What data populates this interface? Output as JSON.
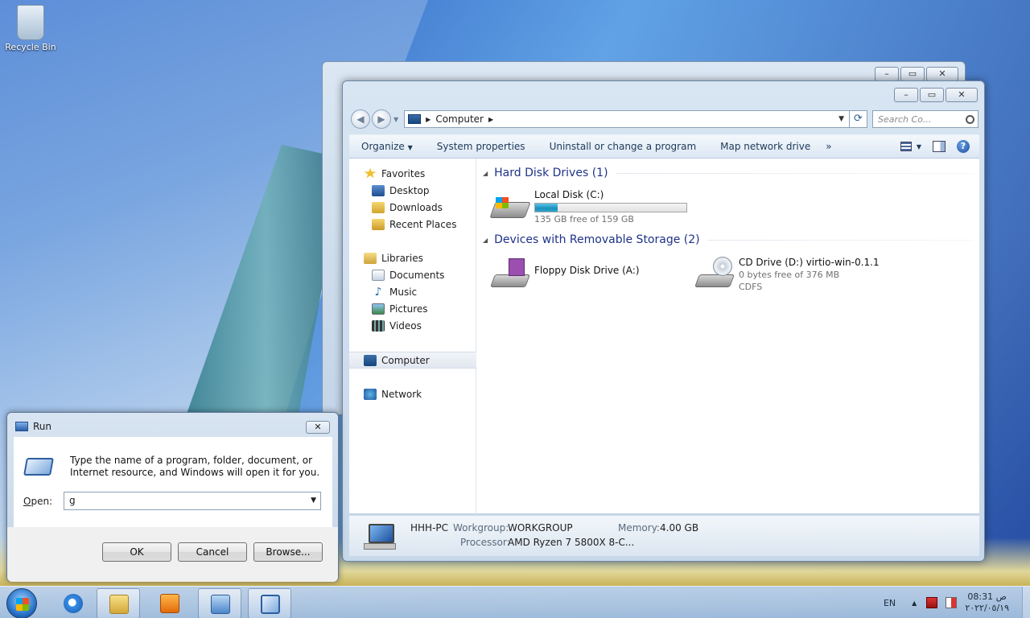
{
  "desktop": {
    "icons": [
      {
        "label": "Recycle Bin",
        "icon": "recycle-bin-icon"
      }
    ]
  },
  "explorer": {
    "address": {
      "crumb": "Computer"
    },
    "search_placeholder": "Search Co...",
    "toolbar": {
      "organize": "Organize",
      "system_properties": "System properties",
      "uninstall": "Uninstall or change a program",
      "map_drive": "Map network drive",
      "more": "»"
    },
    "nav": {
      "favorites": "Favorites",
      "desktop": "Desktop",
      "downloads": "Downloads",
      "recent_places": "Recent Places",
      "libraries": "Libraries",
      "documents": "Documents",
      "music": "Music",
      "pictures": "Pictures",
      "videos": "Videos",
      "computer": "Computer",
      "network": "Network"
    },
    "groups": {
      "hdd": "Hard Disk Drives (1)",
      "removable": "Devices with Removable Storage (2)"
    },
    "drives": {
      "local": {
        "name": "Local Disk (C:)",
        "free": "135 GB free of 159 GB",
        "used_fraction": 0.15
      },
      "floppy": {
        "name": "Floppy Disk Drive (A:)"
      },
      "cd": {
        "name": "CD Drive (D:) virtio-win-0.1.1",
        "free": "0 bytes free of 376 MB",
        "fs": "CDFS"
      }
    },
    "details": {
      "pc_name": "HHH-PC",
      "workgroup_label": "Workgroup:",
      "workgroup": "WORKGROUP",
      "memory_label": "Memory:",
      "memory": "4.00 GB",
      "processor_label": "Processor:",
      "processor": "AMD Ryzen 7 5800X 8-C..."
    }
  },
  "run": {
    "title": "Run",
    "description": "Type the name of a program, folder, document, or Internet resource, and Windows will open it for you.",
    "open_label_pre": "",
    "open_label_u": "O",
    "open_label_post": "pen:",
    "value": "g",
    "ok": "OK",
    "cancel": "Cancel",
    "browse": "Browse..."
  },
  "taskbar": {
    "lang": "EN",
    "time": "08:31 ص",
    "date": "٢٠٢٢/٠٥/١٩"
  }
}
